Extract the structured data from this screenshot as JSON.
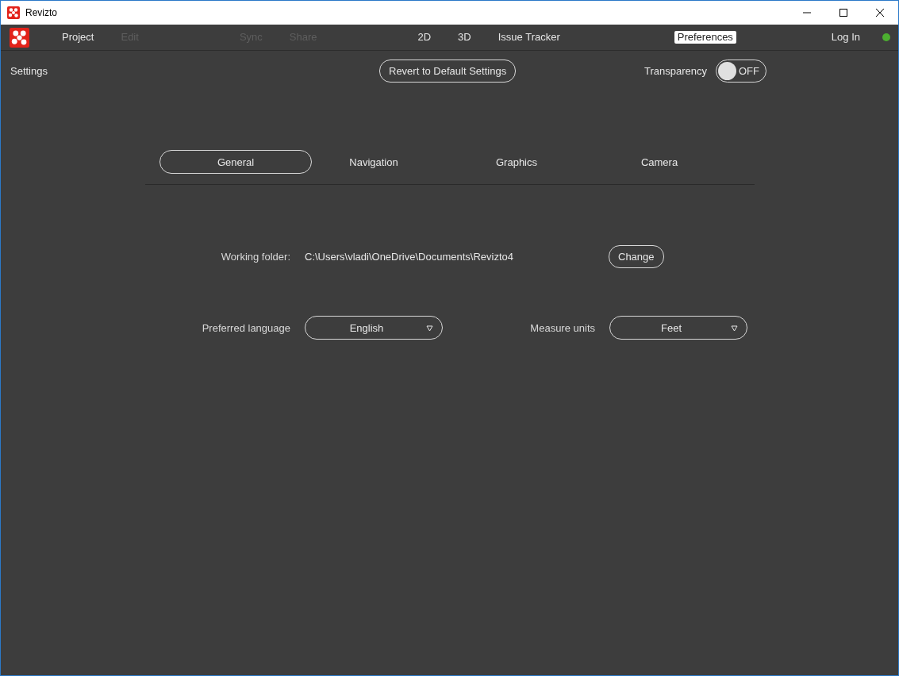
{
  "window": {
    "title": "Revizto"
  },
  "menu": [
    {
      "items": [
        {
          "label": "Project",
          "disabled": false,
          "selected": false
        },
        {
          "label": "Edit",
          "disabled": true,
          "selected": false
        }
      ]
    },
    {
      "items": [
        {
          "label": "Sync",
          "disabled": true,
          "selected": false
        },
        {
          "label": "Share",
          "disabled": true,
          "selected": false
        }
      ]
    },
    {
      "items": [
        {
          "label": "2D",
          "disabled": false,
          "selected": false
        },
        {
          "label": "3D",
          "disabled": false,
          "selected": false
        },
        {
          "label": "Issue Tracker",
          "disabled": false,
          "selected": false
        }
      ]
    },
    {
      "items": [
        {
          "label": "Preferences",
          "disabled": false,
          "selected": true
        }
      ]
    },
    {
      "items": [
        {
          "label": "Log In",
          "disabled": false,
          "selected": false
        }
      ]
    }
  ],
  "status": {
    "color": "#4caf30"
  },
  "header": {
    "title": "Settings",
    "revert_button": "Revert to Default Settings",
    "transparency": {
      "label": "Transparency",
      "on": false,
      "state_text": "OFF"
    }
  },
  "tabs": [
    {
      "label": "General",
      "selected": true
    },
    {
      "label": "Navigation",
      "selected": false
    },
    {
      "label": "Graphics",
      "selected": false
    },
    {
      "label": "Camera",
      "selected": false
    }
  ],
  "working_folder": {
    "label": "Working folder:",
    "value": "C:\\Users\\vladi\\OneDrive\\Documents\\Revizto4",
    "button": "Change"
  },
  "preferred_language": {
    "label": "Preferred language",
    "value": "English"
  },
  "measure_units": {
    "label": "Measure units",
    "value": "Feet"
  }
}
